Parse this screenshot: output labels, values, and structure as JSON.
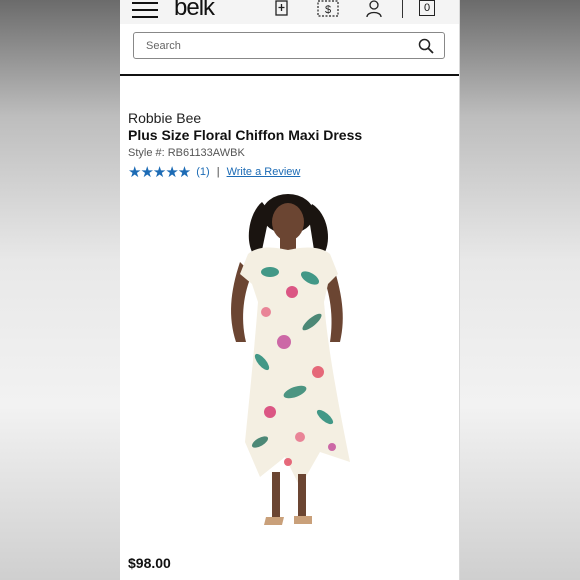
{
  "header": {
    "logo_text": "belk",
    "bag_count": "0",
    "icons": [
      "menu-icon",
      "store-locator-icon",
      "coupon-icon",
      "account-icon",
      "shopping-bag-icon"
    ]
  },
  "search": {
    "placeholder": "Search"
  },
  "product": {
    "brand": "Robbie Bee",
    "title": "Plus Size Floral Chiffon Maxi Dress",
    "style": "Style #: RB61133AWBK",
    "stars": "★★★★★",
    "review_count": "(1)",
    "separator": "|",
    "write_review": "Write a Review",
    "price": "$98.00"
  },
  "colors": {
    "link_blue": "#1c6bb5",
    "text_dark": "#111111"
  }
}
